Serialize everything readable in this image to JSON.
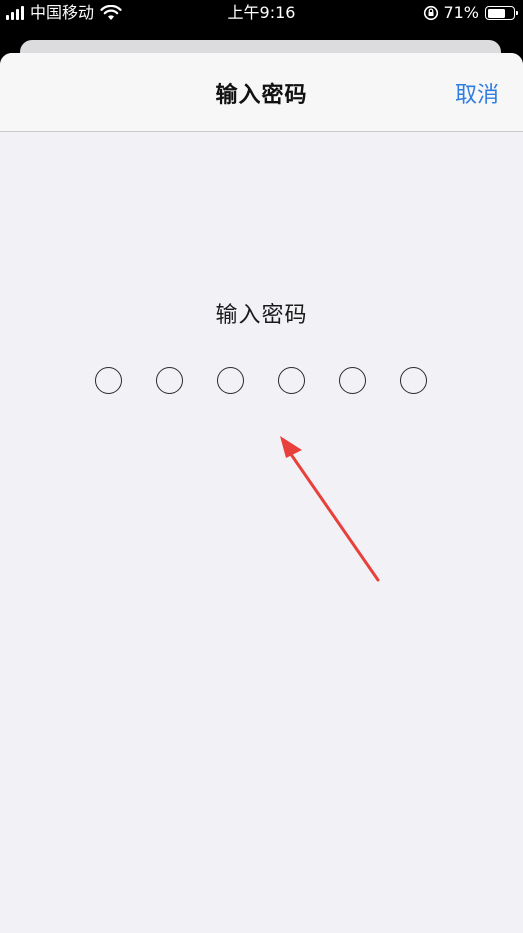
{
  "status_bar": {
    "carrier": "中国移动",
    "time": "上午9:16",
    "battery_percent": "71%",
    "battery_level": 0.71,
    "signal_bars": 4,
    "icons": [
      "signal-icon",
      "wifi-icon",
      "rotation-lock-icon",
      "battery-icon"
    ]
  },
  "nav": {
    "title": "输入密码",
    "cancel_label": "取消",
    "accent_color": "#2f7de1"
  },
  "passcode": {
    "prompt": "输入密码",
    "digit_count": 6,
    "entered_count": 0
  },
  "annotation": {
    "icon": "red-arrow",
    "color": "#e8403a"
  }
}
